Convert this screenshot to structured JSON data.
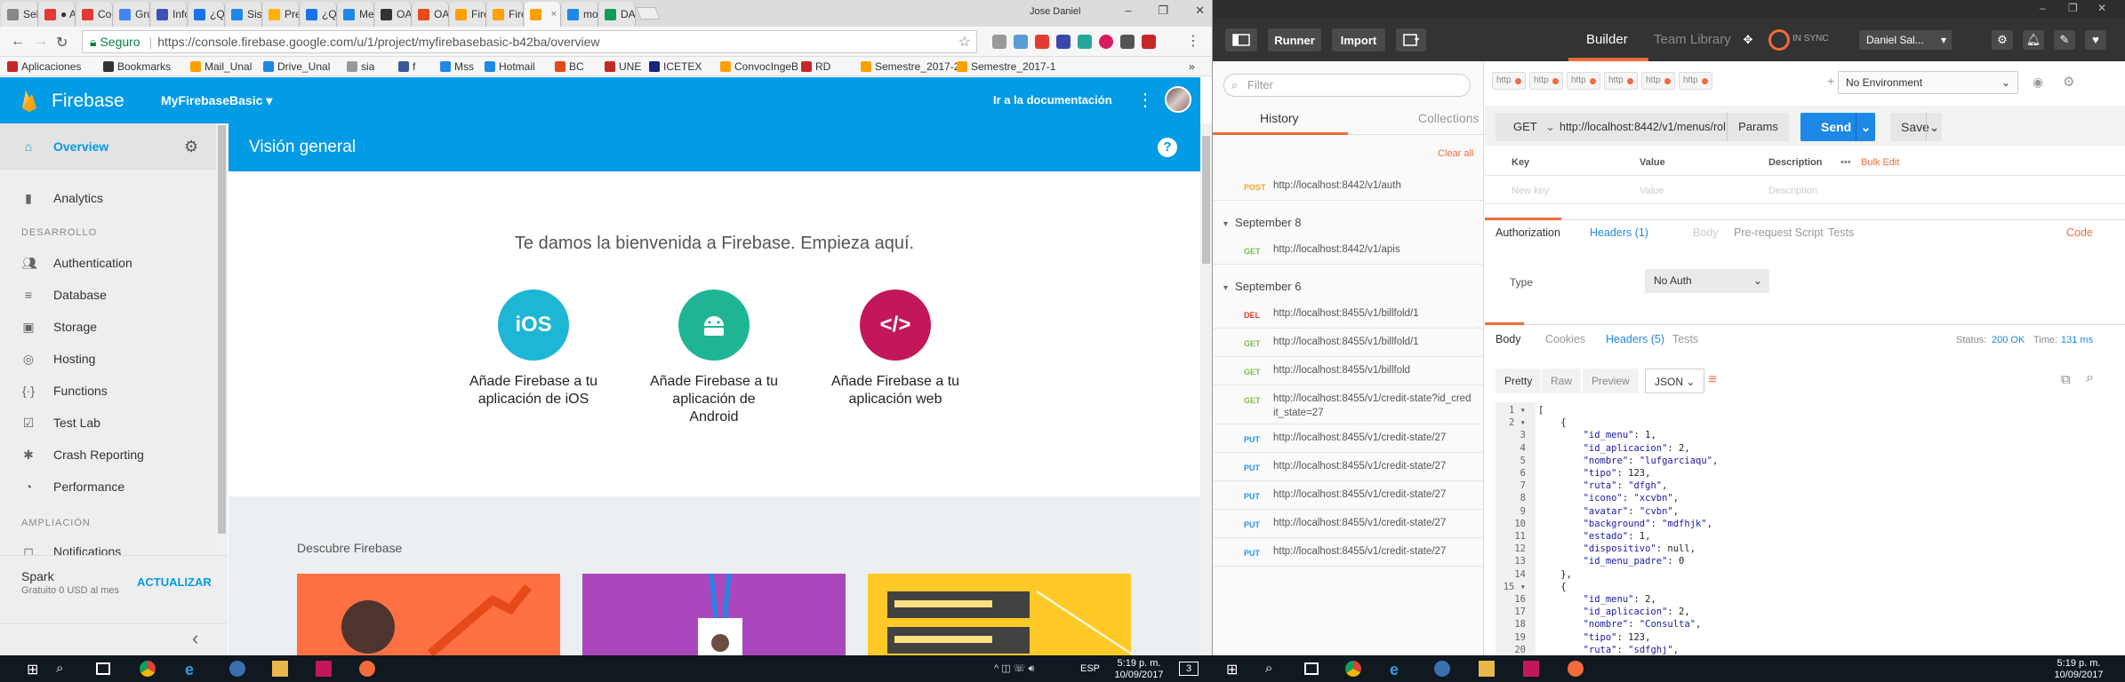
{
  "chrome": {
    "tabs": [
      "Sele",
      "● Au",
      "Con",
      "Grup",
      "Info",
      "¿Qu",
      "Siste",
      "Pres",
      "¿Qu",
      "Mes",
      "OAu",
      "OAu",
      "Fire",
      "Fire",
      "",
      "mov",
      "DAD"
    ],
    "profile": "Jose Daniel",
    "window_controls": [
      "–",
      "❐",
      "✕"
    ],
    "secure_label": "Seguro",
    "url": "https://console.firebase.google.com/u/1/project/myfirebasebasic-b42ba/overview",
    "bookmarks": [
      "Aplicaciones",
      "Bookmarks",
      "Mail_Unal",
      "Drive_Unal",
      "sia",
      "f",
      "Mss",
      "Hotmail",
      "BC",
      "UNE",
      "ICETEX",
      "ConvocIngeB",
      "RD",
      "Semestre_2017-2",
      "Semestre_2017-1"
    ],
    "more": "»"
  },
  "firebase": {
    "brand": "Firebase",
    "project": "MyFirebaseBasic",
    "docs_link": "Ir a la documentación",
    "sidebar": {
      "overview": "Overview",
      "analytics": "Analytics",
      "section_dev": "DESARROLLO",
      "dev_items": [
        "Authentication",
        "Database",
        "Storage",
        "Hosting",
        "Functions",
        "Test Lab",
        "Crash Reporting",
        "Performance"
      ],
      "section_growth": "AMPLIACIÓN",
      "growth_partial": "Notifications",
      "plan": "Spark",
      "plan_detail": "Gratuito 0 USD al mes",
      "upgrade": "ACTUALIZAR",
      "collapse": "‹"
    },
    "page_title": "Visión general",
    "welcome": "Te damos la bienvenida a Firebase. Empieza aquí.",
    "platforms": [
      {
        "icon_text": "iOS",
        "label": "Añade Firebase a tu aplicación de iOS",
        "color": "#1db6d4"
      },
      {
        "icon_text": "android",
        "label": "Añade Firebase a tu aplicación de Android",
        "color": "#1fb594"
      },
      {
        "icon_text": "</>",
        "label": "Añade Firebase a tu aplicación web",
        "color": "#c2185b"
      }
    ],
    "discover": "Descubre Firebase"
  },
  "postman": {
    "runner": "Runner",
    "import": "Import",
    "builder": "Builder",
    "team_library": "Team Library",
    "sync": "IN SYNC",
    "user": "Daniel Sal...",
    "filter_placeholder": "Filter",
    "history_tab": "History",
    "collections_tab": "Collections",
    "clear_all": "Clear all",
    "history": [
      {
        "type": "req",
        "method": "POST",
        "url": "http://localhost:8442/v1/auth"
      },
      {
        "type": "date",
        "label": "September 8"
      },
      {
        "type": "req",
        "method": "GET",
        "url": "http://localhost:8442/v1/apis"
      },
      {
        "type": "date",
        "label": "September 6"
      },
      {
        "type": "req",
        "method": "DEL",
        "url": "http://localhost:8455/v1/billfold/1"
      },
      {
        "type": "req",
        "method": "GET",
        "url": "http://localhost:8455/v1/billfold/1"
      },
      {
        "type": "req",
        "method": "GET",
        "url": "http://localhost:8455/v1/billfold"
      },
      {
        "type": "req",
        "method": "GET",
        "url": "http://localhost:8455/v1/credit-state?id_credit_state=27"
      },
      {
        "type": "req",
        "method": "PUT",
        "url": "http://localhost:8455/v1/credit-state/27"
      },
      {
        "type": "req",
        "method": "PUT",
        "url": "http://localhost:8455/v1/credit-state/27"
      },
      {
        "type": "req",
        "method": "PUT",
        "url": "http://localhost:8455/v1/credit-state/27"
      },
      {
        "type": "req",
        "method": "PUT",
        "url": "http://localhost:8455/v1/credit-state/27"
      },
      {
        "type": "req",
        "method": "PUT",
        "url": "http://localhost:8455/v1/credit-state/27"
      }
    ],
    "request_tabs": [
      "http",
      "http",
      "http",
      "http",
      "http",
      "http"
    ],
    "environment": "No Environment",
    "method": "GET",
    "url": "http://localhost:8442/v1/menus/rol",
    "params": "Params",
    "send": "Send",
    "save": "Save",
    "kv_headers": [
      "Key",
      "Value",
      "Description"
    ],
    "kv_more": "•••",
    "bulk_edit": "Bulk Edit",
    "kv_placeholders": [
      "New key",
      "Value",
      "Description"
    ],
    "req_tabs": [
      "Authorization",
      "Headers (1)",
      "Body",
      "Pre-request Script",
      "Tests"
    ],
    "code_link": "Code",
    "type_label": "Type",
    "type_value": "No Auth",
    "resp_tabs": [
      "Body",
      "Cookies",
      "Headers (5)",
      "Tests"
    ],
    "status_label": "Status:",
    "status_value": "200 OK",
    "time_label": "Time:",
    "time_value": "131 ms",
    "format_tabs": [
      "Pretty",
      "Raw",
      "Preview"
    ],
    "format_type": "JSON",
    "code_lines": [
      "[",
      "    {",
      "        \"id_menu\": 1,",
      "        \"id_aplicacion\": 2,",
      "        \"nombre\": \"lufgarciaqu\",",
      "        \"tipo\": 123,",
      "        \"ruta\": \"dfgh\",",
      "        \"icono\": \"xcvbn\",",
      "        \"avatar\": \"cvbn\",",
      "        \"background\": \"mdfhjk\",",
      "        \"estado\": 1,",
      "        \"dispositivo\": null,",
      "        \"id_menu_padre\": 0",
      "    },",
      "    {",
      "        \"id_menu\": 2,",
      "        \"id_aplicacion\": 2,",
      "        \"nombre\": \"Consulta\",",
      "        \"tipo\": 123,",
      "        \"ruta\": \"sdfghj\","
    ]
  },
  "taskbar": {
    "lang": "ESP",
    "time_left": "5:19 p. m.",
    "date_left": "10/09/2017",
    "time_right": "5:19 p. m.",
    "date_right": "10/09/2017",
    "notif_count": "3"
  },
  "colors": {
    "firebase_blue": "#039be5",
    "postman_orange": "#f26b3a",
    "send_blue": "#1e88e5"
  }
}
